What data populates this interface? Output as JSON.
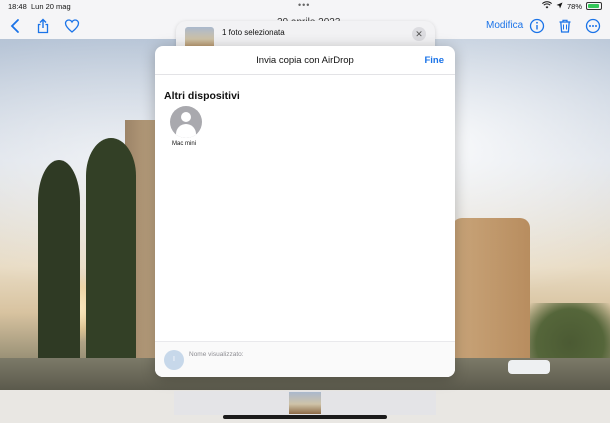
{
  "status_bar": {
    "time": "18:48",
    "date": "Lun 20 mag",
    "dots": "•••",
    "battery_percent": "78%"
  },
  "toolbar": {
    "date_title": "20 aprile 2023",
    "edit_label": "Modifica"
  },
  "header_card": {
    "title": "1 foto selezionata",
    "close_symbol": "✕"
  },
  "sheet": {
    "title": "Invia copia con AirDrop",
    "done_label": "Fine",
    "section_title": "Altri dispositivi",
    "devices": [
      {
        "label": "Mac mini"
      }
    ],
    "footer_initial": "I",
    "footer_text": "Nome visualizzato:"
  },
  "colors": {
    "accent": "#1a73e8",
    "battery": "#34c759"
  }
}
